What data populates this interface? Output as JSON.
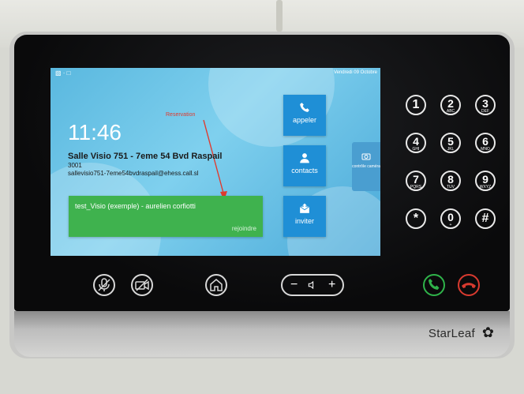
{
  "device": {
    "brand": "StarLeaf"
  },
  "status": {
    "date": "Vendredi 09 Octobre"
  },
  "home": {
    "time": "11:46",
    "room_name": "Salle Visio 751 - 7eme 54 Bvd Raspail",
    "room_number": "3001",
    "room_address": "sallevisio751-7eme54bvdraspail@ehess.call.sl",
    "annotation": "Reservation"
  },
  "meeting": {
    "title": "test_Visio (exemple) - aurelien corfiotti",
    "join_label": "rejoindre"
  },
  "tiles": [
    {
      "label": "appeler",
      "icon": "phone-icon"
    },
    {
      "label": "contacts",
      "icon": "person-icon"
    },
    {
      "label": "inviter",
      "icon": "invite-icon"
    }
  ],
  "side_tab": {
    "label": "contrôle caméra",
    "icon": "camera-control-icon"
  },
  "keypad": [
    {
      "digit": "1",
      "letters": ""
    },
    {
      "digit": "2",
      "letters": "ABC"
    },
    {
      "digit": "3",
      "letters": "DEF"
    },
    {
      "digit": "4",
      "letters": "GHI"
    },
    {
      "digit": "5",
      "letters": "JKL"
    },
    {
      "digit": "6",
      "letters": "MNO"
    },
    {
      "digit": "7",
      "letters": "PQRS"
    },
    {
      "digit": "8",
      "letters": "TUV"
    },
    {
      "digit": "9",
      "letters": "WXYZ"
    },
    {
      "digit": "*",
      "letters": ""
    },
    {
      "digit": "0",
      "letters": "+"
    },
    {
      "digit": "#",
      "letters": ""
    }
  ],
  "controls": {
    "volume_minus": "−",
    "volume_plus": "+"
  },
  "colors": {
    "screen_bg": "#6cc5e9",
    "tile_blue": "#1f8fd6",
    "meeting_green": "#3fb24e",
    "annotation_red": "#e03a2e",
    "call_green": "#2fb34a",
    "hangup_red": "#d83a2f"
  }
}
